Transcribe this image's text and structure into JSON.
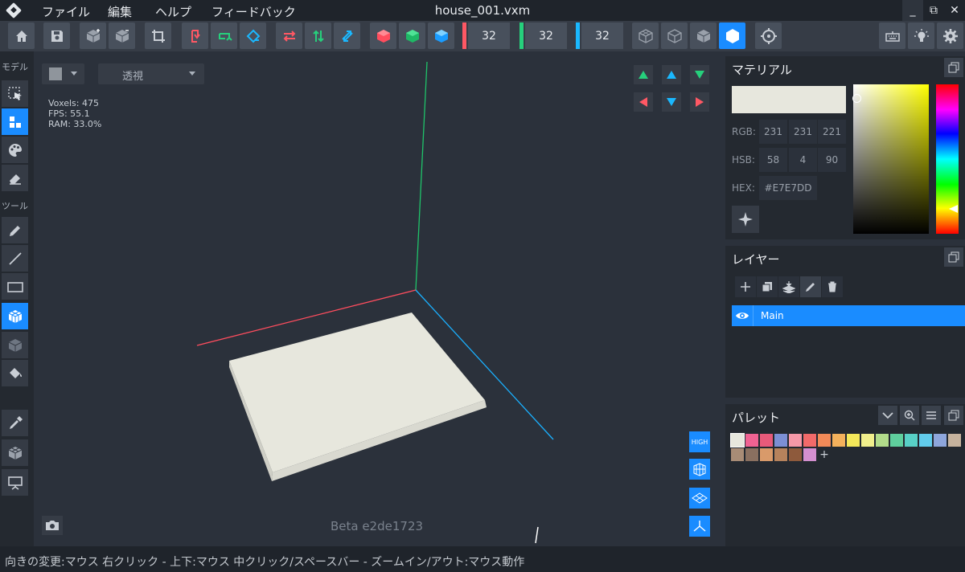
{
  "window": {
    "title": "house_001.vxm",
    "menu": [
      "ファイル",
      "編集",
      "ヘルプ",
      "フィードバック"
    ],
    "controls": {
      "minimize": "_",
      "restore": "⧉",
      "close": "✕"
    }
  },
  "toolbar": {
    "axis_sizes": [
      {
        "axis": "x",
        "value": "32",
        "color": "#ff5864"
      },
      {
        "axis": "y",
        "value": "32",
        "color": "#26d07c"
      },
      {
        "axis": "z",
        "value": "32",
        "color": "#1ab8ff"
      }
    ],
    "icons": [
      "home-icon",
      "save-icon",
      "cube-add-icon",
      "cube-remove-icon",
      "crop-icon",
      "flip-x-icon",
      "flip-y-icon",
      "flip-z-icon",
      "swap-x-icon",
      "swap-y-icon",
      "swap-z-icon",
      "red-cube-icon",
      "green-cube-icon",
      "blue-cube-icon",
      "wire-cube-icon",
      "wire-cube-2-icon",
      "solid-cube-icon",
      "hexagon-icon",
      "target-icon",
      "keyboard-icon",
      "bulb-icon",
      "gear-icon"
    ],
    "colors": {
      "accent": "#1a8cff"
    }
  },
  "left_sidebar": {
    "section_model": "モデル",
    "section_tools": "ツール",
    "model_icons": [
      "select-icon",
      "voxel-mode-icon",
      "palette-icon",
      "eraser-icon"
    ],
    "tool_icons": [
      "pencil-icon",
      "line-icon",
      "rectangle-icon",
      "cube-fill-icon",
      "cube-paint-icon",
      "bucket-icon"
    ],
    "extra_icons": [
      "eyedropper-icon",
      "cube-pick-icon",
      "presentation-icon"
    ]
  },
  "viewport": {
    "color_selector_value": "",
    "view_mode": "透視",
    "stats": {
      "voxels": "Voxels: 475",
      "fps": "FPS: 55.1",
      "ram": "RAM: 33.0%"
    },
    "beta_label": "Beta e2de1723",
    "render_quality": "HIGH",
    "axis_colors": {
      "x": "#ff4d5e",
      "y": "#1fc46a",
      "z": "#1ab0ff"
    },
    "model_color": "#e7e7dd"
  },
  "material": {
    "title": "マテリアル",
    "current_color": "#E7E7DD",
    "rgb_label": "RGB:",
    "rgb": [
      "231",
      "231",
      "221"
    ],
    "hsb_label": "HSB:",
    "hsb": [
      "58",
      "4",
      "90"
    ],
    "hex_label": "HEX:",
    "hex": "#E7E7DD"
  },
  "layers": {
    "title": "レイヤー",
    "items": [
      {
        "name": "Main",
        "visible": true
      }
    ]
  },
  "palette": {
    "title": "パレット",
    "colors": [
      "#e7e7dd",
      "#f06292",
      "#e85a7a",
      "#7c8fd4",
      "#f598a8",
      "#f16a6a",
      "#f28a58",
      "#f4b15c",
      "#f4e85a",
      "#f1ef8c",
      "#b2dc8a",
      "#5fcf9d",
      "#58d0c6",
      "#62ccec",
      "#8ea6dc",
      "#c6b39e",
      "#a88c76",
      "#8a7060",
      "#d99a6a",
      "#b6825c",
      "#8e5a3c",
      "#d48fd0"
    ],
    "add": "+"
  },
  "status": {
    "text": "向きの変更:マウス 右クリック - 上下:マウス 中クリック/スペースバー - ズームイン/アウト:マウス動作"
  }
}
